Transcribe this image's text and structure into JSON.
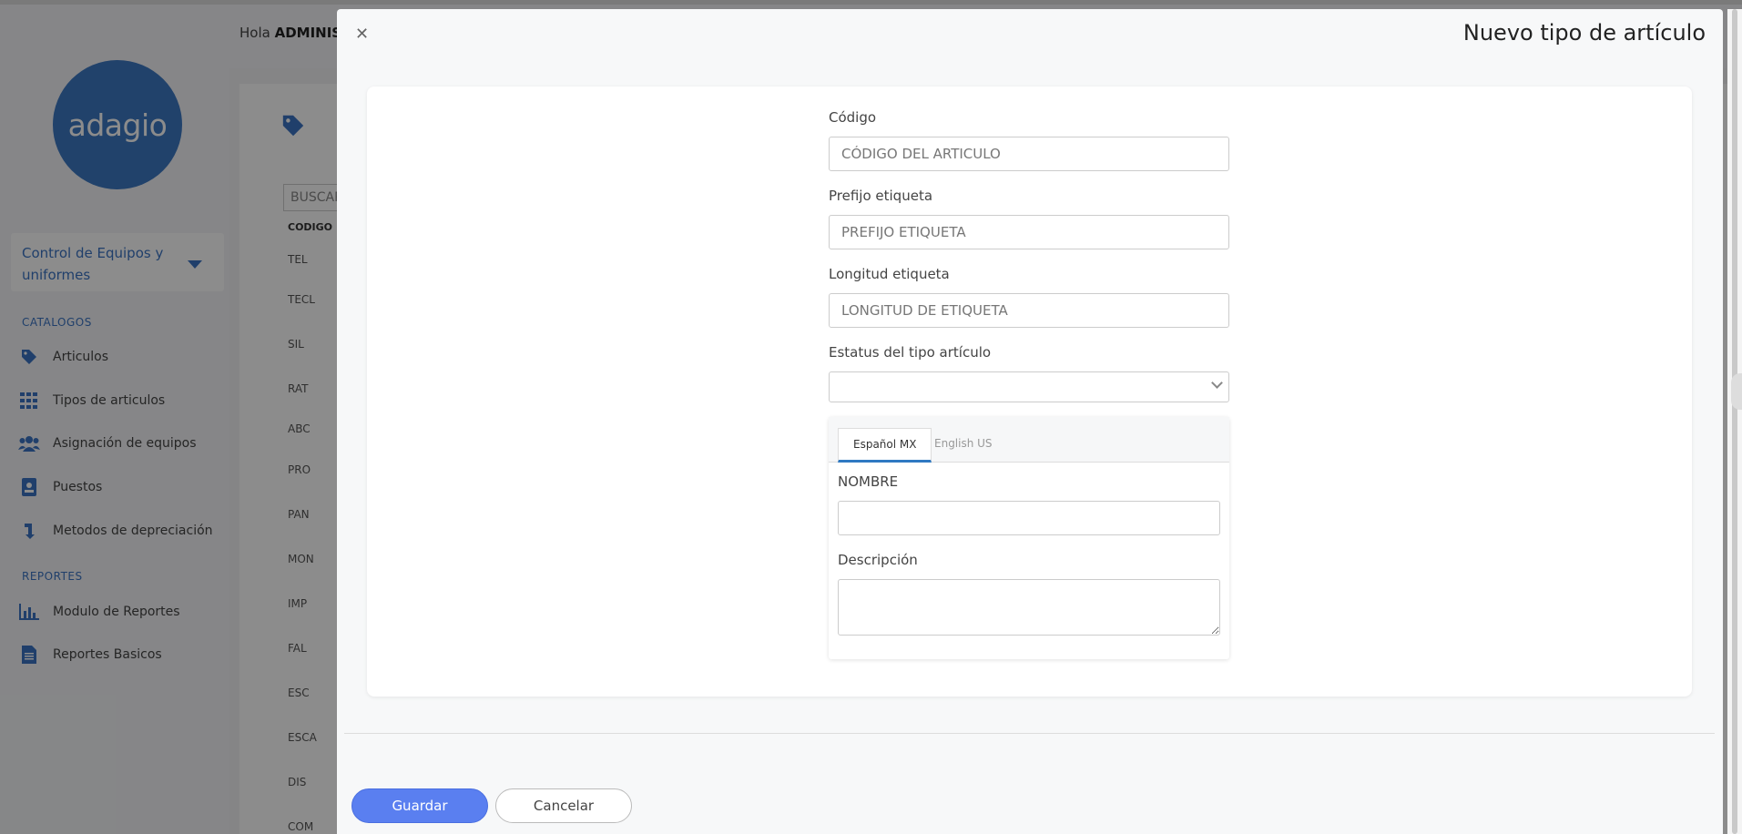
{
  "background": {
    "logo_text": "adagio",
    "greeting_prefix": "Hola",
    "greeting_user": "ADMINIST",
    "module_selector": "Control de Equipos y uniformes",
    "sections": {
      "catalogos": "CATALOGOS",
      "reportes": "REPORTES"
    },
    "nav": [
      {
        "label": "Articulos",
        "icon": "tag-icon"
      },
      {
        "label": "Tipos de articulos",
        "icon": "grid-icon"
      },
      {
        "label": "Asignación de equipos",
        "icon": "users-icon"
      },
      {
        "label": "Puestos",
        "icon": "badge-icon"
      },
      {
        "label": "Metodos de depreciación",
        "icon": "depreciation-icon"
      },
      {
        "label": "Modulo de Reportes",
        "icon": "bar-chart-icon"
      },
      {
        "label": "Reportes Basicos",
        "icon": "document-icon"
      }
    ],
    "search_text": "BUSCAR",
    "table_header": "CODIGO",
    "codes": [
      "TEL",
      "TECL",
      "SIL",
      "RAT",
      "ABC",
      "PRO",
      "PAN",
      "MON",
      "IMP",
      "FAL",
      "ESC",
      "ESCA",
      "DIS",
      "COM"
    ]
  },
  "modal": {
    "title": "Nuevo tipo de artículo",
    "close_icon": "close-icon",
    "fields": {
      "codigo_label": "Código",
      "codigo_placeholder": "CÓDIGO DEL ARTICULO",
      "prefijo_label": "Prefijo etiqueta",
      "prefijo_placeholder": "PREFIJO ETIQUETA",
      "longitud_label": "Longitud etiqueta",
      "longitud_placeholder": "LONGITUD DE ETIQUETA",
      "estatus_label": "Estatus del tipo artículo",
      "estatus_value": ""
    },
    "language_tabs": [
      {
        "label": "Español MX",
        "active": true
      },
      {
        "label": "English US",
        "active": false
      }
    ],
    "nombre_label": "NOMBRE",
    "nombre_value": "",
    "descripcion_label": "Descripción",
    "descripcion_value": "",
    "save_label": "Guardar",
    "cancel_label": "Cancelar"
  },
  "colors": {
    "accent": "#3b74c3",
    "save_button": "#5a7ff0",
    "tab_underline": "#2f79c2"
  }
}
